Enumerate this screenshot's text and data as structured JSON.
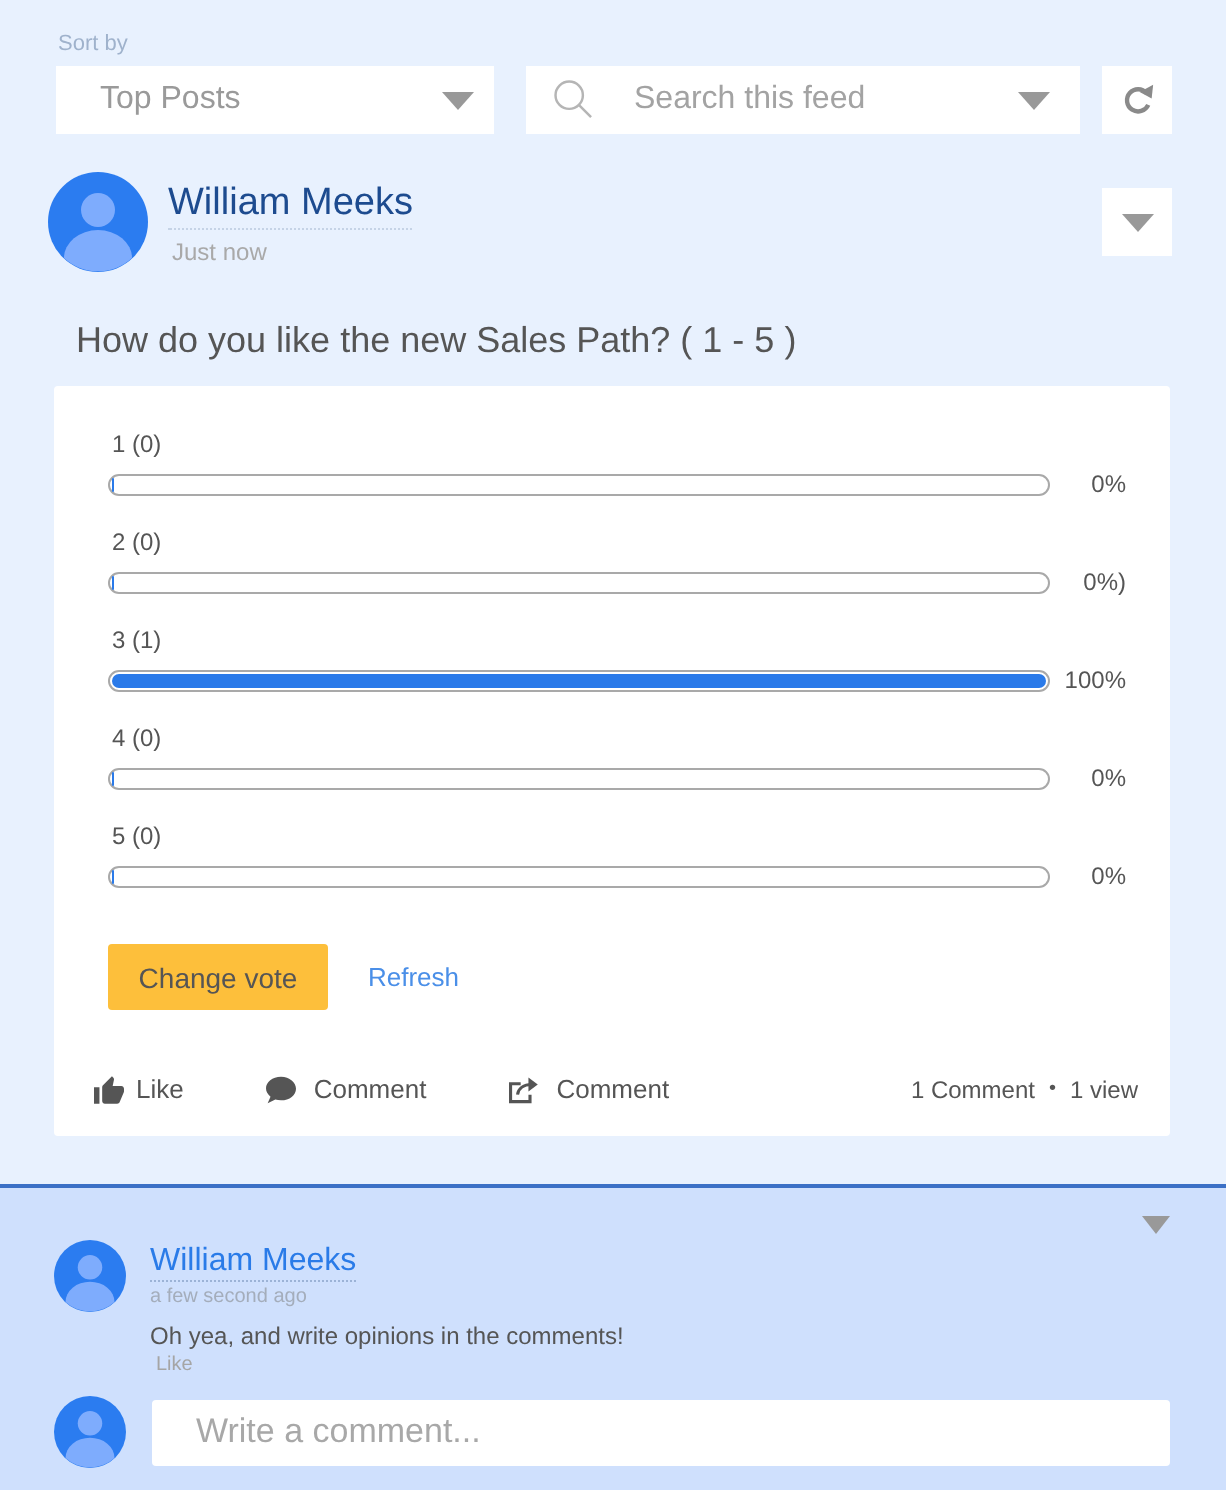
{
  "sort": {
    "label": "Sort by",
    "value": "Top Posts"
  },
  "search": {
    "placeholder": "Search this feed"
  },
  "post": {
    "author": "William Meeks",
    "time": "Just now",
    "question": "How do you like the new Sales Path? ( 1 - 5 )",
    "poll": [
      {
        "label": "1 (0)",
        "level": 0,
        "reading": "0%"
      },
      {
        "label": "2 (0)",
        "level": 0,
        "reading": "0%)"
      },
      {
        "label": "3 (1)",
        "level": 1,
        "reading": "100%"
      },
      {
        "label": "4 (0)",
        "level": 0,
        "reading": "0%"
      },
      {
        "label": "5 (0)",
        "level": 0,
        "reading": "0%"
      }
    ],
    "vote_button": "Change vote",
    "refresh_link": "Refresh",
    "actions": [
      {
        "kind": "like",
        "label": "Like"
      },
      {
        "kind": "comment",
        "label": "Comment"
      },
      {
        "kind": "share",
        "label": "Comment"
      }
    ],
    "stats": {
      "comments": "1 Comment",
      "separator": "•",
      "views": "1 view"
    }
  },
  "comments": [
    {
      "author": "William Meeks",
      "time": "a few second ago",
      "text": "Oh yea, and write opinions in the comments!",
      "like": "Like"
    }
  ],
  "reply": {
    "placeholder": "Write a comment..."
  }
}
